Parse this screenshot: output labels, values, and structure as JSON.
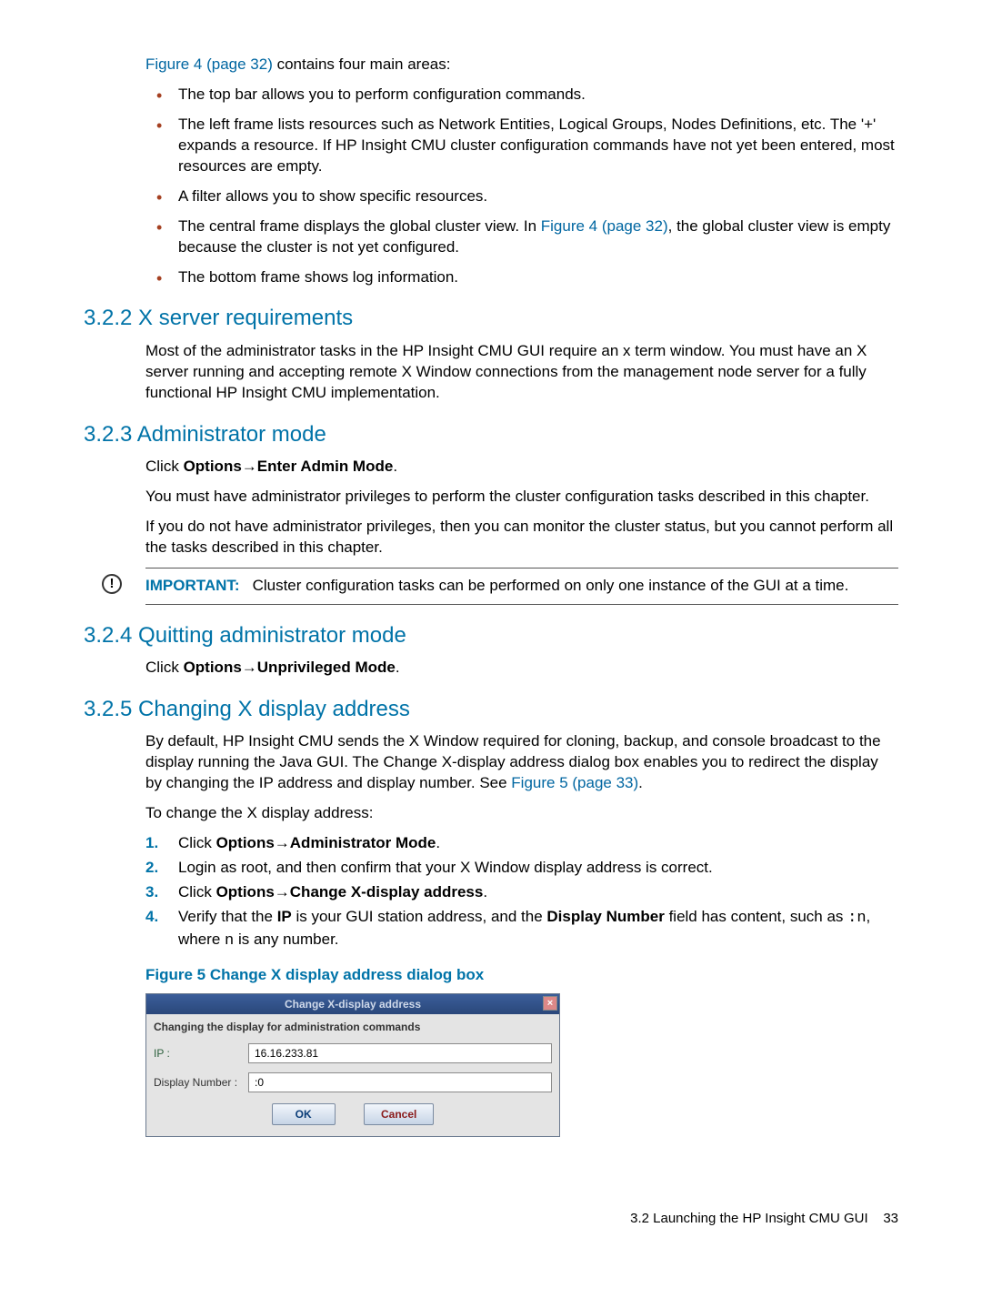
{
  "intro": {
    "fig_link": "Figure 4 (page 32)",
    "intro_tail": " contains four main areas:",
    "bullets": {
      "b1": "The top bar allows you to perform configuration commands.",
      "b2": "The left frame lists resources such as Network Entities, Logical Groups, Nodes Definitions, etc. The '+' expands a resource. If HP Insight CMU cluster configuration commands have not yet been entered, most resources are empty.",
      "b3": "A filter allows you to show specific resources.",
      "b4_pre": "The central frame displays the global cluster view. In ",
      "b4_link": "Figure 4 (page 32)",
      "b4_post": ", the global cluster view is empty because the cluster is not yet configured.",
      "b5": "The bottom frame shows log information."
    }
  },
  "s322": {
    "heading": "3.2.2 X server requirements",
    "body": "Most of the administrator tasks in the HP Insight CMU GUI require an x term window. You must have an X server running and accepting remote X Window connections from the management node server for a fully functional HP Insight CMU implementation."
  },
  "s323": {
    "heading": "3.2.3 Administrator mode",
    "click_pre": "Click ",
    "click_bold": "Options→Enter Admin Mode",
    "click_post": ".",
    "p1": "You must have administrator privileges to perform the cluster configuration tasks described in this chapter.",
    "p2": "If you do not have administrator privileges, then you can monitor the cluster status, but you cannot perform all the tasks described in this chapter.",
    "important_label": "IMPORTANT:",
    "important_text": "Cluster configuration tasks can be performed on only one instance of the GUI at a time."
  },
  "s324": {
    "heading": "3.2.4 Quitting administrator mode",
    "click_pre": "Click ",
    "click_bold": "Options→Unprivileged Mode",
    "click_post": "."
  },
  "s325": {
    "heading": "3.2.5 Changing X display address",
    "p1_pre": "By default, HP Insight CMU sends the X Window required for cloning, backup, and console broadcast to the display running the Java GUI. The Change X-display address dialog box enables you to redirect the display by changing the IP address and display number. See ",
    "p1_link": "Figure 5 (page 33)",
    "p1_post": ".",
    "p2": "To change the X display address:",
    "steps": {
      "s1_pre": "Click ",
      "s1_bold": "Options→Administrator Mode",
      "s1_post": ".",
      "s2": "Login as root, and then confirm that your X Window display address is correct.",
      "s3_pre": "Click ",
      "s3_bold": "Options→Change X-display address",
      "s3_post": ".",
      "s4_pre": "Verify that the ",
      "s4_b1": "IP",
      "s4_mid": " is your GUI station address, and the ",
      "s4_b2": "Display Number",
      "s4_post1": " field has content, such as ",
      "s4_mono1": ":n",
      "s4_post2": ", where ",
      "s4_mono2": "n",
      "s4_post3": " is any number."
    },
    "fig_caption": "Figure 5 Change X display address dialog box"
  },
  "dialog": {
    "title": "Change X-display address",
    "close": "×",
    "subhead": "Changing the display for administration commands",
    "ip_label": "IP :",
    "ip_value": "16.16.233.81",
    "disp_label": "Display Number :",
    "disp_value": ":0",
    "ok": "OK",
    "cancel": "Cancel"
  },
  "footer": {
    "text": "3.2 Launching the HP Insight CMU GUI",
    "page": "33"
  }
}
